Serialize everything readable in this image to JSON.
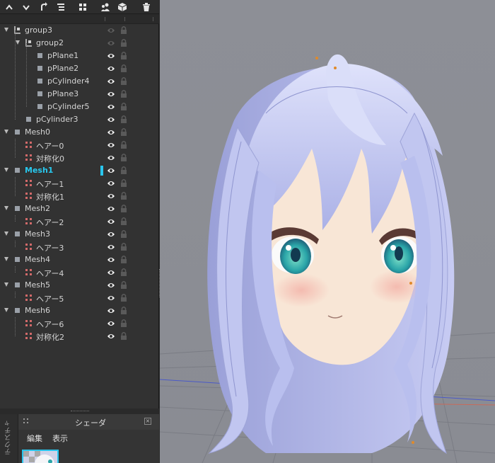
{
  "toolbar": {
    "buttons": [
      {
        "icon": "chevron-up-icon"
      },
      {
        "icon": "chevron-down-icon"
      },
      {
        "icon": "rotate-icon"
      },
      {
        "icon": "hierarchy-icon"
      },
      {
        "icon": "grid-icon"
      },
      {
        "icon": "people-icon"
      },
      {
        "icon": "cube-icon"
      },
      {
        "icon": "trash-icon"
      }
    ]
  },
  "outliner": {
    "rows": [
      {
        "label": "group3",
        "type": "group",
        "depth": 0,
        "expanded": true,
        "visible": false,
        "active": false
      },
      {
        "label": "group2",
        "type": "group",
        "depth": 1,
        "expanded": true,
        "visible": false,
        "active": false
      },
      {
        "label": "pPlane1",
        "type": "mesh",
        "depth": 2,
        "visible": true,
        "active": false
      },
      {
        "label": "pPlane2",
        "type": "mesh",
        "depth": 2,
        "visible": true,
        "active": false
      },
      {
        "label": "pCylinder4",
        "type": "mesh",
        "depth": 2,
        "visible": true,
        "active": false
      },
      {
        "label": "pPlane3",
        "type": "mesh",
        "depth": 2,
        "visible": true,
        "active": false
      },
      {
        "label": "pCylinder5",
        "type": "mesh",
        "depth": 2,
        "visible": true,
        "active": false
      },
      {
        "label": "pCylinder3",
        "type": "mesh",
        "depth": 1,
        "visible": true,
        "active": false
      },
      {
        "label": "Mesh0",
        "type": "mesh",
        "depth": 0,
        "expanded": true,
        "visible": true,
        "active": false
      },
      {
        "label": "ヘアー0",
        "type": "deform",
        "depth": 1,
        "visible": true,
        "active": false
      },
      {
        "label": "対称化0",
        "type": "deform",
        "depth": 1,
        "visible": true,
        "active": false
      },
      {
        "label": "Mesh1",
        "type": "mesh",
        "depth": 0,
        "expanded": true,
        "visible": true,
        "active": true
      },
      {
        "label": "ヘアー1",
        "type": "deform",
        "depth": 1,
        "visible": true,
        "active": false
      },
      {
        "label": "対称化1",
        "type": "deform",
        "depth": 1,
        "visible": true,
        "active": false
      },
      {
        "label": "Mesh2",
        "type": "mesh",
        "depth": 0,
        "expanded": true,
        "visible": true,
        "active": false
      },
      {
        "label": "ヘアー2",
        "type": "deform",
        "depth": 1,
        "visible": true,
        "active": false
      },
      {
        "label": "Mesh3",
        "type": "mesh",
        "depth": 0,
        "expanded": true,
        "visible": true,
        "active": false
      },
      {
        "label": "ヘアー3",
        "type": "deform",
        "depth": 1,
        "visible": true,
        "active": false
      },
      {
        "label": "Mesh4",
        "type": "mesh",
        "depth": 0,
        "expanded": true,
        "visible": true,
        "active": false
      },
      {
        "label": "ヘアー4",
        "type": "deform",
        "depth": 1,
        "visible": true,
        "active": false
      },
      {
        "label": "Mesh5",
        "type": "mesh",
        "depth": 0,
        "expanded": true,
        "visible": true,
        "active": false
      },
      {
        "label": "ヘアー5",
        "type": "deform",
        "depth": 1,
        "visible": true,
        "active": false
      },
      {
        "label": "Mesh6",
        "type": "mesh",
        "depth": 0,
        "expanded": true,
        "visible": true,
        "active": false
      },
      {
        "label": "ヘアー6",
        "type": "deform",
        "depth": 1,
        "visible": true,
        "active": false
      },
      {
        "label": "対称化2",
        "type": "deform",
        "depth": 1,
        "visible": true,
        "active": false
      }
    ]
  },
  "shader_panel": {
    "side_tab": "テクスチャ",
    "title": "シェーダ",
    "menu_edit": "編集",
    "menu_view": "表示"
  },
  "colors": {
    "accent": "#29c6ee",
    "panel_bg": "#323232",
    "viewport_bg": "#8b8d94",
    "hair": "#c9cdf2",
    "skin": "#f8e6d6",
    "eye": "#2aa5a8"
  }
}
